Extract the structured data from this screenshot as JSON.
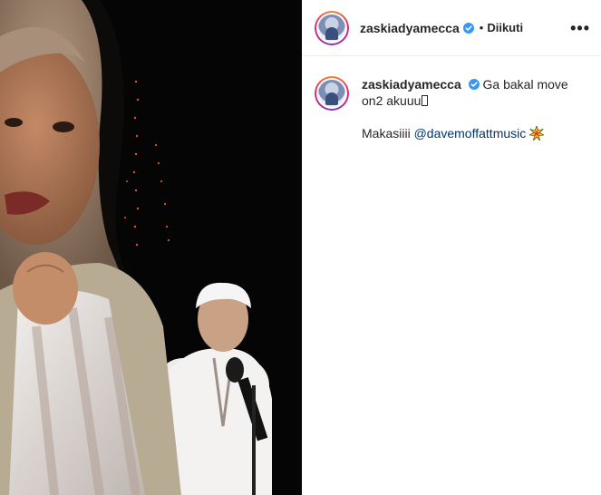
{
  "post": {
    "header": {
      "username": "zaskiadyamecca",
      "separator": "•",
      "follow_status": "Diikuti",
      "more_icon": "more-horizontal-icon"
    },
    "caption": {
      "username": "zaskiadyamecca",
      "text_line1": "Ga bakal move on2 akuuu",
      "text_line2_prefix": "Makasiiii ",
      "mention": "@davemoffattmusic",
      "emoji_icon": "collision-emoji-icon"
    },
    "colors": {
      "verified_blue": "#3897f0",
      "link": "#00376b",
      "media_background": "#050505"
    }
  }
}
